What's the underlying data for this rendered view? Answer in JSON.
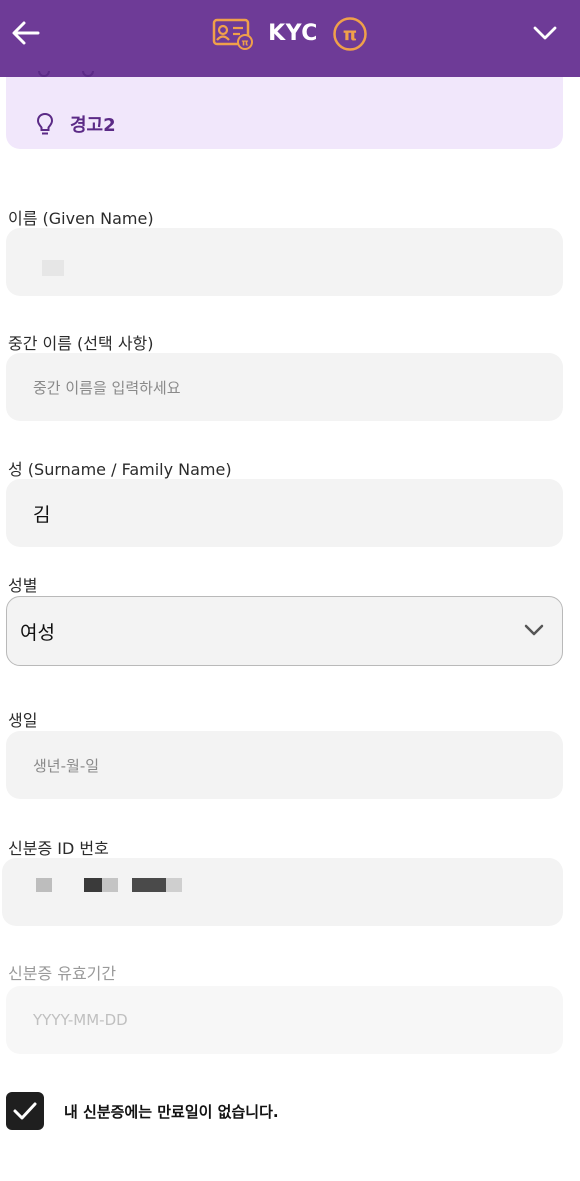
{
  "header": {
    "title": "KYC",
    "colors": {
      "bar": "#6e3b97",
      "badge": "#f0a04a"
    }
  },
  "warning": {
    "label": "경고2"
  },
  "form": {
    "given_name": {
      "label": "이름 (Given Name)"
    },
    "middle_name": {
      "label": "중간 이름 (선택 사항)",
      "placeholder": "중간 이름을 입력하세요"
    },
    "surname": {
      "label": "성 (Surname / Family Name)",
      "value": "김"
    },
    "gender": {
      "label": "성별",
      "value": "여성"
    },
    "birthday": {
      "label": "생일",
      "placeholder": "생년-월-일"
    },
    "id_number": {
      "label": "신분증 ID 번호"
    },
    "id_expiry": {
      "label": "신분증 유효기간",
      "placeholder": "YYYY-MM-DD"
    },
    "no_expiry": {
      "label": "내 신분증에는 만료일이 없습니다.",
      "checked": true
    }
  }
}
